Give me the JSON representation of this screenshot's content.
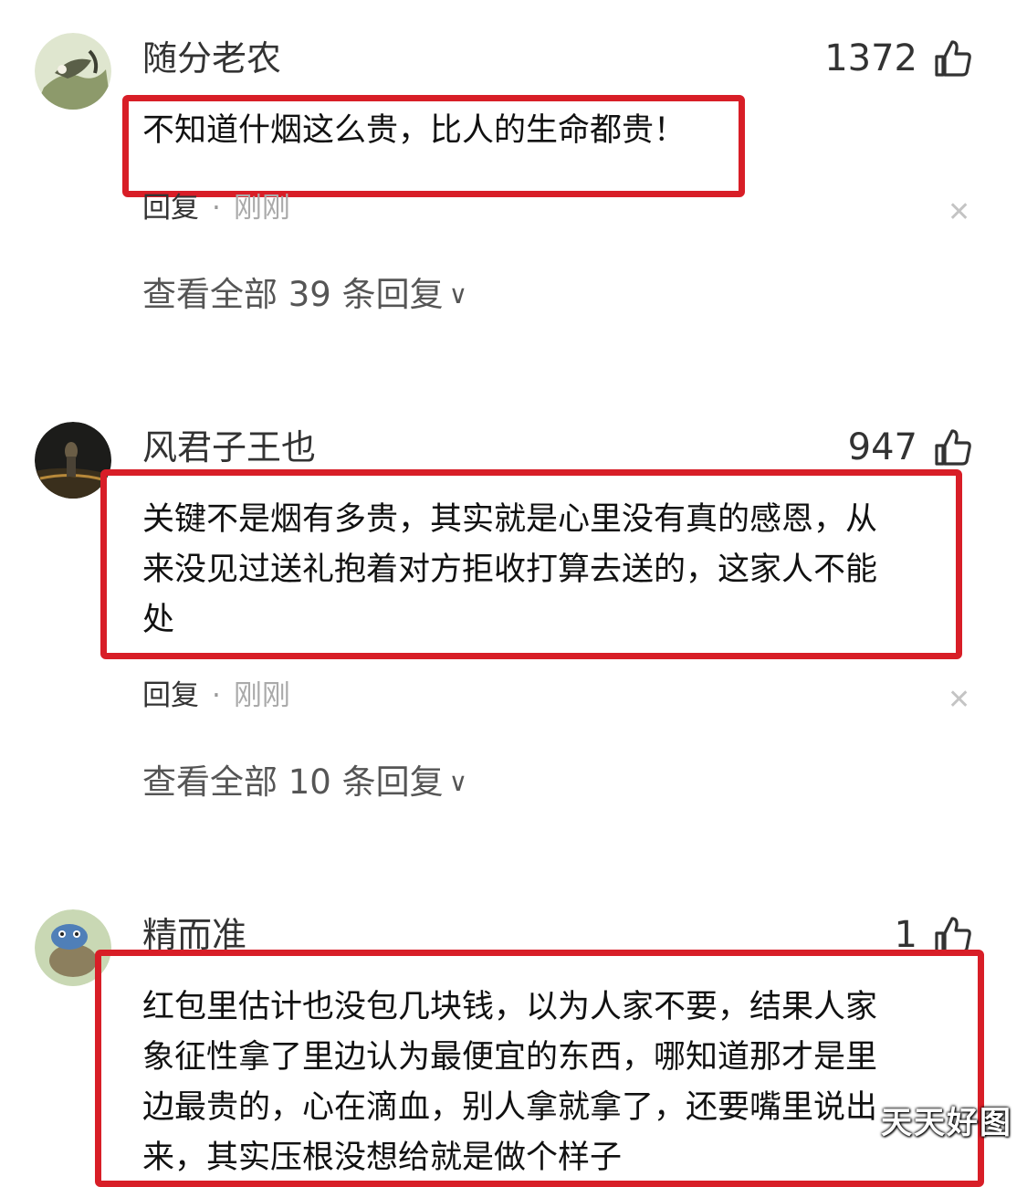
{
  "comments": [
    {
      "username": "随分老农",
      "likes": "1372",
      "lines": [
        "不知道什烟这么贵，比人的生命都贵！"
      ],
      "reply_label": "回复",
      "separator": "·",
      "time": "刚刚",
      "view_all": "查看全部 39 条回复"
    },
    {
      "username": "风君子王也",
      "likes": "947",
      "lines": [
        "关键不是烟有多贵，其实就是心里没有真的感恩，从",
        "来没见过送礼抱着对方拒收打算去送的，这家人不能",
        "处"
      ],
      "reply_label": "回复",
      "separator": "·",
      "time": "刚刚",
      "view_all": "查看全部 10 条回复"
    },
    {
      "username": "精而准",
      "likes": "1",
      "lines": [
        "红包里估计也没包几块钱，以为人家不要，结果人家",
        "象征性拿了里边认为最便宜的东西，哪知道那才是里",
        "边最贵的，心在滴血，别人拿就拿了，还要嘴里说出",
        "来，其实压根没想给就是做个样子"
      ]
    }
  ],
  "icons": {
    "like": "thumbs-up-icon",
    "close": "close-icon",
    "chevron": "chevron-down-icon"
  },
  "colors": {
    "highlight_border": "#d81e27",
    "muted_text": "#aaaaaa"
  },
  "watermark": "天天好图"
}
